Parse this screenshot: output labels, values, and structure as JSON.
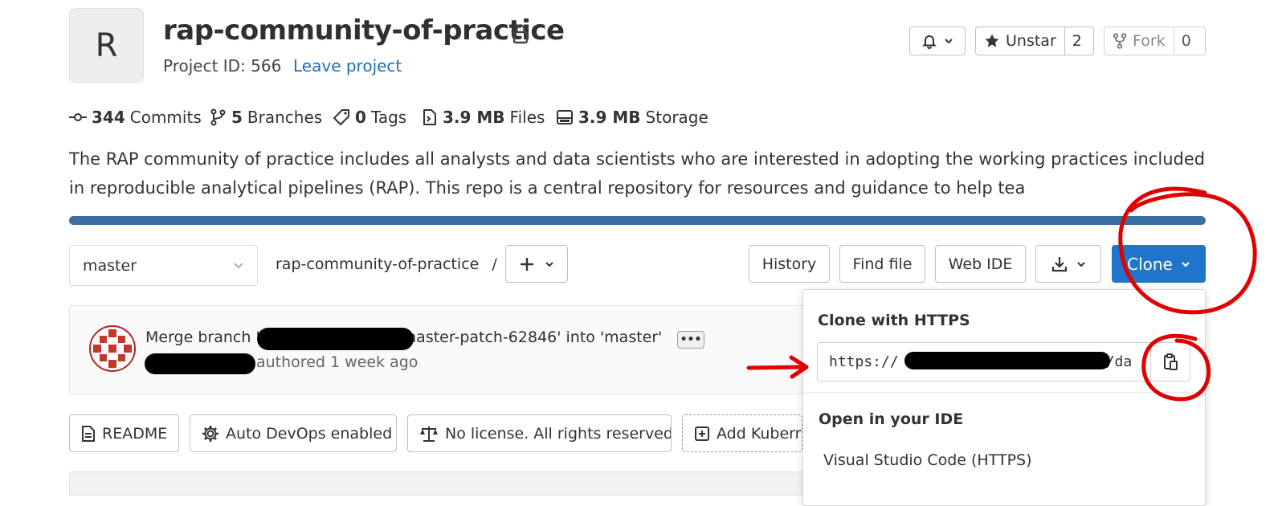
{
  "project": {
    "avatar_letter": "R",
    "name": "rap-community-of-practice",
    "id_text": "Project ID: 566",
    "leave_label": "Leave project"
  },
  "header_actions": {
    "unstar_label": "Unstar",
    "star_count": "2",
    "fork_label": "Fork",
    "fork_count": "0"
  },
  "stats": {
    "commits_count": "344",
    "commits_label": "Commits",
    "branches_count": "5",
    "branches_label": "Branches",
    "tags_count": "0",
    "tags_label": "Tags",
    "files_size": "3.9 MB",
    "files_label": "Files",
    "storage_size": "3.9 MB",
    "storage_label": "Storage"
  },
  "description": "The RAP community of practice includes all analysts and data scientists who are interested in adopting the working practices included in reproducible analytical pipelines (RAP). This repo is a central repository for resources and guidance to help tea",
  "toolbar": {
    "branch": "master",
    "path": "rap-community-of-practice",
    "path_sep": "/",
    "history_label": "History",
    "find_file_label": "Find file",
    "web_ide_label": "Web IDE",
    "clone_label": "Clone"
  },
  "commit": {
    "message_prefix": "Merge branch '",
    "message_suffix": "master-patch-62846' into 'master'",
    "meta": "authored 1 week ago",
    "ellipsis": "•••"
  },
  "badges": {
    "readme": "README",
    "auto_devops": "Auto DevOps enabled",
    "license": "No license. All rights reserved",
    "kubernetes": "Add Kuberr"
  },
  "clone_dropdown": {
    "https_header": "Clone with HTTPS",
    "https_url_start": "https://",
    "https_url_end": "/da",
    "ide_header": "Open in your IDE",
    "vscode_https": "Visual Studio Code (HTTPS)"
  },
  "colors": {
    "accent": "#1f75cb",
    "link": "#1f6fb5",
    "progress_bar": "#3a6e9e",
    "annotation": "#e00000"
  },
  "icons": [
    "lock-icon",
    "bell-icon",
    "star-icon",
    "fork-icon",
    "commit-icon",
    "branch-icon",
    "tag-icon",
    "file-icon",
    "storage-icon",
    "plus-icon",
    "download-icon",
    "chevron-down-icon",
    "copy-icon",
    "readme-icon",
    "gear-icon",
    "scale-icon",
    "add-square-icon"
  ]
}
